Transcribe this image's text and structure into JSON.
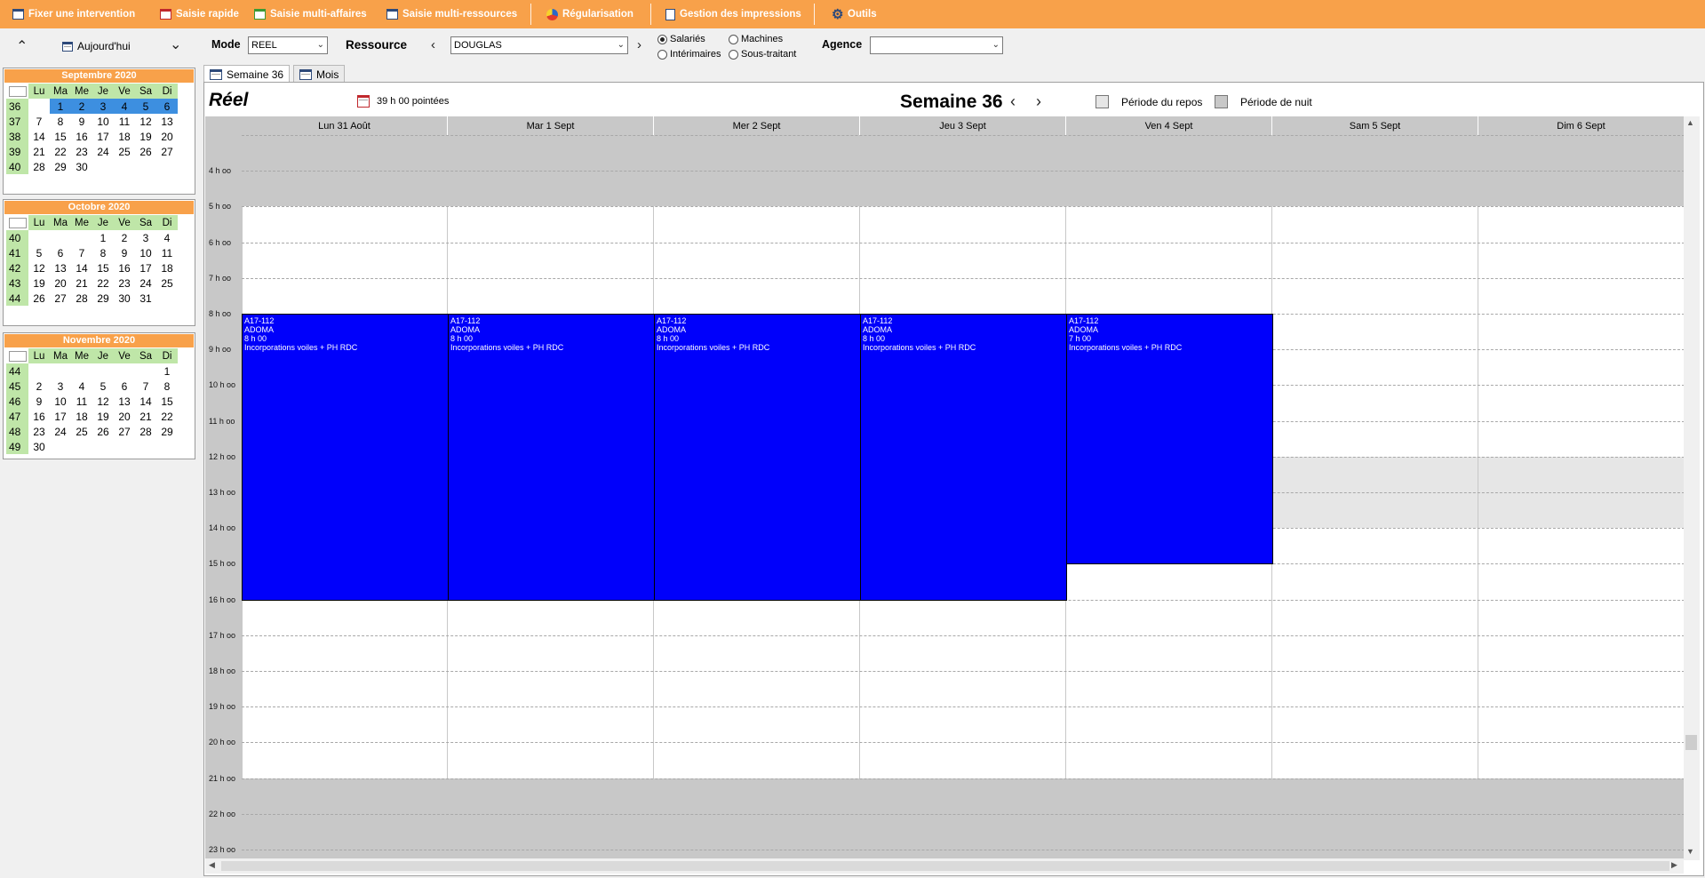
{
  "toolbar": {
    "items": [
      {
        "label": "Fixer une intervention",
        "icon": "calendar-icon"
      },
      {
        "label": "Saisie rapide",
        "icon": "calendar-red-icon"
      },
      {
        "label": "Saisie multi-affaires",
        "icon": "calendar-green-icon"
      },
      {
        "label": "Saisie multi-ressources",
        "icon": "calendar-icon"
      },
      {
        "label": "Régularisation",
        "icon": "pie-chart-icon"
      },
      {
        "label": "Gestion des impressions",
        "icon": "document-icon"
      },
      {
        "label": "Outils",
        "icon": "gear-icon"
      }
    ]
  },
  "controls": {
    "today_label": "Aujourd'hui",
    "mode_label": "Mode",
    "mode_value": "REEL",
    "resource_label": "Ressource",
    "resource_value": "DOUGLAS",
    "radios": [
      {
        "label": "Salariés",
        "checked": true
      },
      {
        "label": "Machines",
        "checked": false
      },
      {
        "label": "Intérimaires",
        "checked": false
      },
      {
        "label": "Sous-traitant",
        "checked": false
      }
    ],
    "agency_label": "Agence",
    "agency_value": ""
  },
  "mini_calendars": [
    {
      "title": "Septembre 2020",
      "days": [
        "Lu",
        "Ma",
        "Me",
        "Je",
        "Ve",
        "Sa",
        "Di"
      ],
      "weeks": [
        {
          "wk": "36",
          "d": [
            "",
            "1",
            "2",
            "3",
            "4",
            "5",
            "6"
          ],
          "selected": true
        },
        {
          "wk": "37",
          "d": [
            "7",
            "8",
            "9",
            "10",
            "11",
            "12",
            "13"
          ]
        },
        {
          "wk": "38",
          "d": [
            "14",
            "15",
            "16",
            "17",
            "18",
            "19",
            "20"
          ]
        },
        {
          "wk": "39",
          "d": [
            "21",
            "22",
            "23",
            "24",
            "25",
            "26",
            "27"
          ]
        },
        {
          "wk": "40",
          "d": [
            "28",
            "29",
            "30",
            "",
            "",
            "",
            ""
          ]
        }
      ]
    },
    {
      "title": "Octobre 2020",
      "days": [
        "Lu",
        "Ma",
        "Me",
        "Je",
        "Ve",
        "Sa",
        "Di"
      ],
      "weeks": [
        {
          "wk": "40",
          "d": [
            "",
            "",
            "",
            "1",
            "2",
            "3",
            "4"
          ]
        },
        {
          "wk": "41",
          "d": [
            "5",
            "6",
            "7",
            "8",
            "9",
            "10",
            "11"
          ]
        },
        {
          "wk": "42",
          "d": [
            "12",
            "13",
            "14",
            "15",
            "16",
            "17",
            "18"
          ]
        },
        {
          "wk": "43",
          "d": [
            "19",
            "20",
            "21",
            "22",
            "23",
            "24",
            "25"
          ]
        },
        {
          "wk": "44",
          "d": [
            "26",
            "27",
            "28",
            "29",
            "30",
            "31",
            ""
          ]
        }
      ]
    },
    {
      "title": "Novembre 2020",
      "days": [
        "Lu",
        "Ma",
        "Me",
        "Je",
        "Ve",
        "Sa",
        "Di"
      ],
      "weeks": [
        {
          "wk": "44",
          "d": [
            "",
            "",
            "",
            "",
            "",
            "",
            "1"
          ]
        },
        {
          "wk": "45",
          "d": [
            "2",
            "3",
            "4",
            "5",
            "6",
            "7",
            "8"
          ]
        },
        {
          "wk": "46",
          "d": [
            "9",
            "10",
            "11",
            "12",
            "13",
            "14",
            "15"
          ]
        },
        {
          "wk": "47",
          "d": [
            "16",
            "17",
            "18",
            "19",
            "20",
            "21",
            "22"
          ]
        },
        {
          "wk": "48",
          "d": [
            "23",
            "24",
            "25",
            "26",
            "27",
            "28",
            "29"
          ]
        },
        {
          "wk": "49",
          "d": [
            "30",
            "",
            "",
            "",
            "",
            "",
            ""
          ]
        }
      ]
    }
  ],
  "tabs": [
    {
      "label": "Semaine 36",
      "active": true
    },
    {
      "label": "Mois",
      "active": false
    }
  ],
  "planning": {
    "mode_title": "Réel",
    "hours_total": "39 h 00 pointées",
    "week_title": "Semaine 36",
    "legend": [
      {
        "label": "Période du repos",
        "color": "#e6e6e6"
      },
      {
        "label": "Période de nuit",
        "color": "#c8c8c8"
      }
    ],
    "columns": [
      "Lun 31 Août",
      "Mar 1 Sept",
      "Mer 2 Sept",
      "Jeu 3 Sept",
      "Ven 4 Sept",
      "Sam 5 Sept",
      "Dim 6 Sept"
    ],
    "hours": [
      "4 h oo",
      "5 h oo",
      "6 h oo",
      "7 h oo",
      "8 h oo",
      "9 h oo",
      "10 h oo",
      "11 h oo",
      "12 h oo",
      "13 h oo",
      "14 h oo",
      "15 h oo",
      "16 h oo",
      "17 h oo",
      "18 h oo",
      "19 h oo",
      "20 h oo",
      "21 h oo",
      "22 h oo",
      "23 h oo"
    ],
    "first_hour": 3,
    "night_ranges": [
      [
        3,
        5
      ],
      [
        21,
        24
      ]
    ],
    "rest_range_weekend": [
      12,
      14
    ],
    "events": [
      {
        "day": 0,
        "start": 8,
        "end": 16,
        "lines": [
          "A17-112",
          "ADOMA",
          "8 h 00",
          "Incorporations voiles + PH RDC"
        ]
      },
      {
        "day": 1,
        "start": 8,
        "end": 16,
        "lines": [
          "A17-112",
          "ADOMA",
          "8 h 00",
          "Incorporations voiles + PH RDC"
        ]
      },
      {
        "day": 2,
        "start": 8,
        "end": 16,
        "lines": [
          "A17-112",
          "ADOMA",
          "8 h 00",
          "Incorporations voiles + PH RDC"
        ]
      },
      {
        "day": 3,
        "start": 8,
        "end": 16,
        "lines": [
          "A17-112",
          "ADOMA",
          "8 h 00",
          "Incorporations voiles + PH RDC"
        ]
      },
      {
        "day": 4,
        "start": 8,
        "end": 15,
        "lines": [
          "A17-112",
          "ADOMA",
          "7 h 00",
          "Incorporations voiles + PH RDC"
        ]
      }
    ]
  }
}
